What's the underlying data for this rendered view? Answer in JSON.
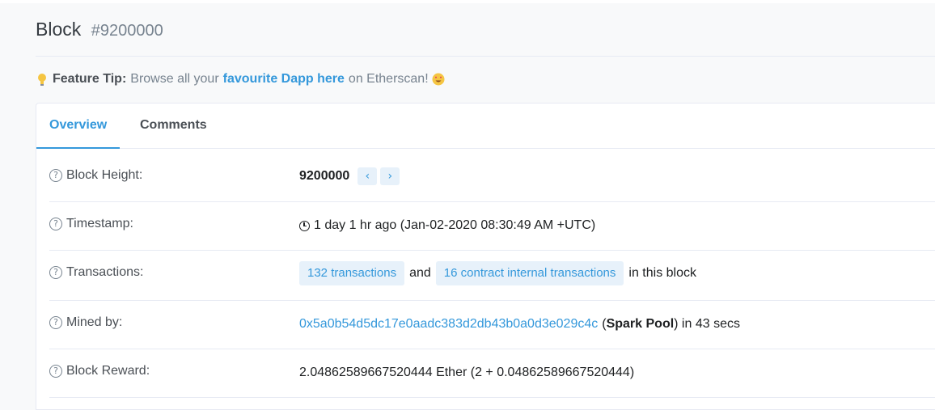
{
  "header": {
    "title": "Block",
    "subtitle": "#9200000"
  },
  "tip": {
    "label": "Feature Tip:",
    "text_before": "Browse all your",
    "link_text": "favourite Dapp here",
    "text_after": "on Etherscan!"
  },
  "tabs": [
    {
      "label": "Overview",
      "active": true
    },
    {
      "label": "Comments",
      "active": false
    }
  ],
  "overview": {
    "block_height": {
      "label": "Block Height:",
      "value": "9200000",
      "prev_icon": "chevron-left-icon",
      "next_icon": "chevron-right-icon"
    },
    "timestamp": {
      "label": "Timestamp:",
      "value": "1 day 1 hr ago (Jan-02-2020 08:30:49 AM +UTC)"
    },
    "transactions": {
      "label": "Transactions:",
      "tx_link": "132 transactions",
      "and_text": "and",
      "internal_link": "16 contract internal transactions",
      "suffix": "in this block"
    },
    "mined_by": {
      "label": "Mined by:",
      "address": "0x5a0b54d5dc17e0aadc383d2db43b0a0d3e029c4c",
      "open_paren": "(",
      "pool": "Spark Pool",
      "suffix": ") in 43 secs"
    },
    "block_reward": {
      "label": "Block Reward:",
      "value": "2.04862589667520444 Ether (2 + 0.04862589667520444)"
    }
  },
  "colors": {
    "accent": "#3498db",
    "background": "#f8f9fa",
    "pill_bg": "#e7f1fa"
  }
}
